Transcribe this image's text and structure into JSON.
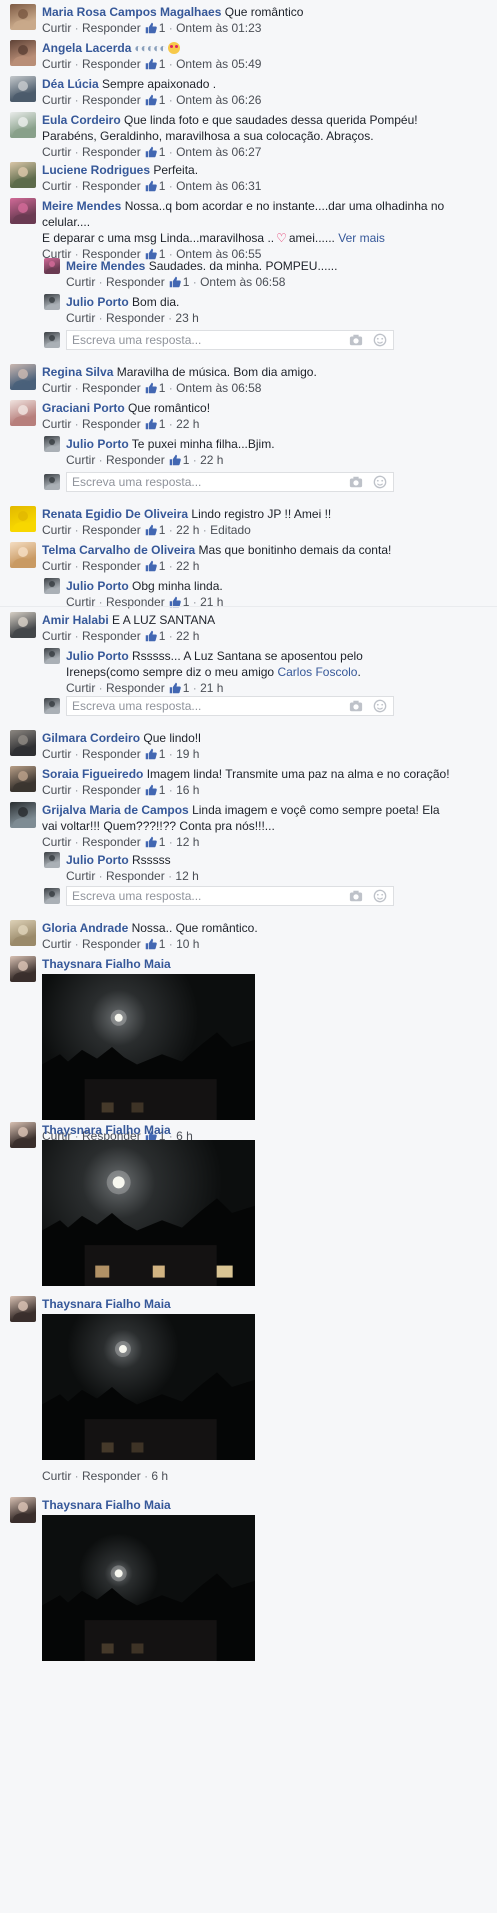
{
  "reply_placeholder": "Escreva uma resposta...",
  "actions": {
    "like": "Curtir",
    "reply": "Responder"
  },
  "comments": [
    {
      "name": "Maria Rosa Campos Magalhaes",
      "text": "Que romântico",
      "likes": "1",
      "time": "Ontem às 01:23"
    },
    {
      "name": "Angela Lacerda",
      "text": "",
      "likes": "1",
      "time": "Ontem às 05:49"
    },
    {
      "name": "Déa Lúcia",
      "text": "Sempre apaixonado .",
      "likes": "1",
      "time": "Ontem às 06:26"
    },
    {
      "name": "Eula Cordeiro",
      "text": "Que linda foto e que saudades dessa querida Pompéu! Parabéns, Geraldinho, maravilhosa a sua colocação. Abraços.",
      "likes": "1",
      "time": "Ontem às 06:27"
    },
    {
      "name": "Luciene Rodrigues",
      "text": "Perfeita.",
      "likes": "1",
      "time": "Ontem às 06:31"
    },
    {
      "name": "Meire Mendes",
      "text": "Nossa..q bom acordar e no instante....dar uma olhadinha no celular....",
      "text2": "E deparar c uma msg Linda...maravilhosa ..",
      "text3": "amei......",
      "more": "Ver mais",
      "likes": "1",
      "time": "Ontem às 06:55"
    },
    {
      "name": "Meire Mendes",
      "text": "Saudades. da minha. POMPEU......",
      "likes": "1",
      "time": "Ontem às 06:58"
    },
    {
      "name": "Julio Porto",
      "text": "Bom dia.",
      "time": "23 h"
    },
    {
      "name": "Regina Silva",
      "text": "Maravilha de música. Bom dia amigo.",
      "likes": "1",
      "time": "Ontem às 06:58"
    },
    {
      "name": "Graciani Porto",
      "text": "Que romântico!",
      "likes": "1",
      "time": "22 h"
    },
    {
      "name": "Julio Porto",
      "text": "Te puxei minha filha...Bjim.",
      "likes": "1",
      "time": "22 h"
    },
    {
      "name": "Renata Egidio De Oliveira",
      "text": "Lindo registro JP !! Amei !!",
      "likes": "1",
      "time": "22 h",
      "edited": "Editado"
    },
    {
      "name": "Telma Carvalho de Oliveira",
      "text": "Mas que bonitinho demais da conta!",
      "likes": "1",
      "time": "22 h"
    },
    {
      "name": "Julio Porto",
      "text": "Obg minha linda.",
      "likes": "1",
      "time": "21 h"
    },
    {
      "name": "Amir Halabi",
      "text": "E A LUZ SANTANA",
      "likes": "1",
      "time": "22 h"
    },
    {
      "name": "Julio Porto",
      "text": "Rsssss... A Luz Santana se aposentou pelo Ireneps(como sempre diz o meu amigo",
      "link": "Carlos Foscolo",
      "likes": "1",
      "time": "21 h"
    },
    {
      "name": "Gilmara Cordeiro",
      "text": "Que lindo!l",
      "likes": "1",
      "time": "19 h"
    },
    {
      "name": "Soraia Figueiredo",
      "text": "Imagem linda! Transmite uma paz na alma e no coração!",
      "likes": "1",
      "time": "16 h"
    },
    {
      "name": "Grijalva Maria de Campos",
      "text": "Linda imagem e voçê como sempre poeta! Ela vai voltar!!! Quem???!!?? Conta pra nós!!!...",
      "likes": "1",
      "time": "12 h"
    },
    {
      "name": "Julio Porto",
      "text": "Rsssss",
      "time": "12 h"
    },
    {
      "name": "Gloria Andrade",
      "text": "Nossa.. Que romântico.",
      "likes": "1",
      "time": "10 h"
    },
    {
      "name": "Thaysnara Fialho Maia",
      "likes": "1",
      "time": "6 h"
    },
    {
      "name": "Thaysnara Fialho Maia"
    },
    {
      "name": "Thaysnara Fialho Maia",
      "time": "6 h"
    },
    {
      "name": "Thaysnara Fialho Maia"
    }
  ],
  "colors": {
    "name": "#365899",
    "meta": "#90949c",
    "background": "#f6f7f9",
    "like": "#4267b2"
  }
}
